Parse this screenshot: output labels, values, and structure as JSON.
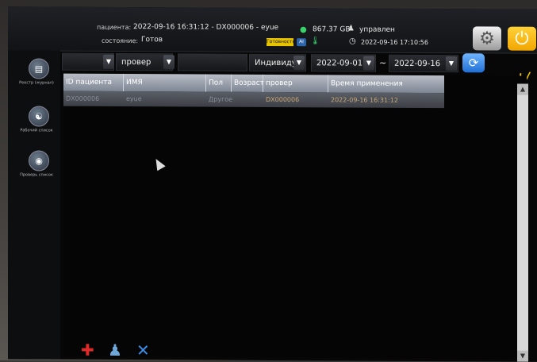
{
  "header": {
    "patient_prefix": "пациента:",
    "patient_info": "2022-09-16 16:31:12 - DX000006 - eyue",
    "state_label": "состояние:",
    "state_value": "Готов",
    "ready_badge": "Готовность",
    "disk_space": "867.37 GB",
    "user": "управлен",
    "clock": "2022-09-16 17:10:56"
  },
  "filters": {
    "field1_value": "",
    "field2_value": "провер",
    "field3_value": "",
    "mode_value": "Индивидуа",
    "date_from": "2022-09-01",
    "range_sep": "~",
    "date_to": "2022-09-16"
  },
  "sidebar": {
    "items": [
      {
        "label": "Реестр (журнал)"
      },
      {
        "label": "Рабочий список"
      },
      {
        "label": "Проверь список"
      }
    ]
  },
  "table": {
    "columns": [
      "ID пациента",
      "ИМЯ",
      "Пол",
      "Возраст",
      "провер",
      "Время применения"
    ],
    "rows": [
      {
        "id": "DX000006",
        "name": "eyue",
        "sex": "Другое",
        "age": "",
        "check": "DX000006",
        "time": "2022-09-16 16:31:12"
      }
    ]
  },
  "colors": {
    "accent_yellow": "#f5c400",
    "accent_blue": "#1f6fd6"
  }
}
